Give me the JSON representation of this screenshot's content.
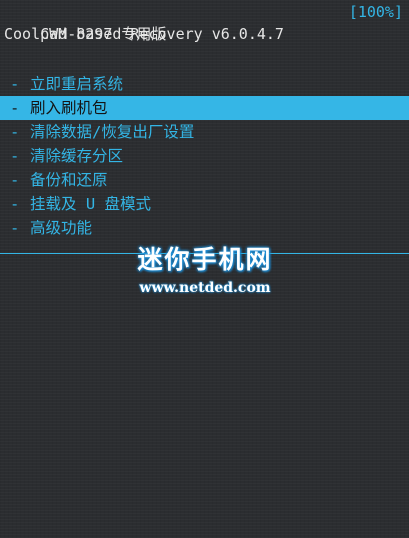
{
  "header": {
    "title": "CWM-based Recovery v6.0.4.7",
    "battery": "[100%]",
    "device": "Coolpad 8297 专用版"
  },
  "menu": {
    "bullet": "-",
    "items": [
      {
        "label": "立即重启系统",
        "selected": false
      },
      {
        "label": "刷入刷机包",
        "selected": true
      },
      {
        "label": "清除数据/恢复出厂设置",
        "selected": false
      },
      {
        "label": "清除缓存分区",
        "selected": false
      },
      {
        "label": "备份和还原",
        "selected": false
      },
      {
        "label": "挂载及 U 盘模式",
        "selected": false
      },
      {
        "label": "高级功能",
        "selected": false
      }
    ]
  },
  "watermark": {
    "title": "迷你手机网",
    "url": "www.netded.com"
  },
  "colors": {
    "accent": "#33b5e5",
    "background": "#2b2d30",
    "header_text": "#e6e6e6",
    "selected_text": "#141414"
  }
}
